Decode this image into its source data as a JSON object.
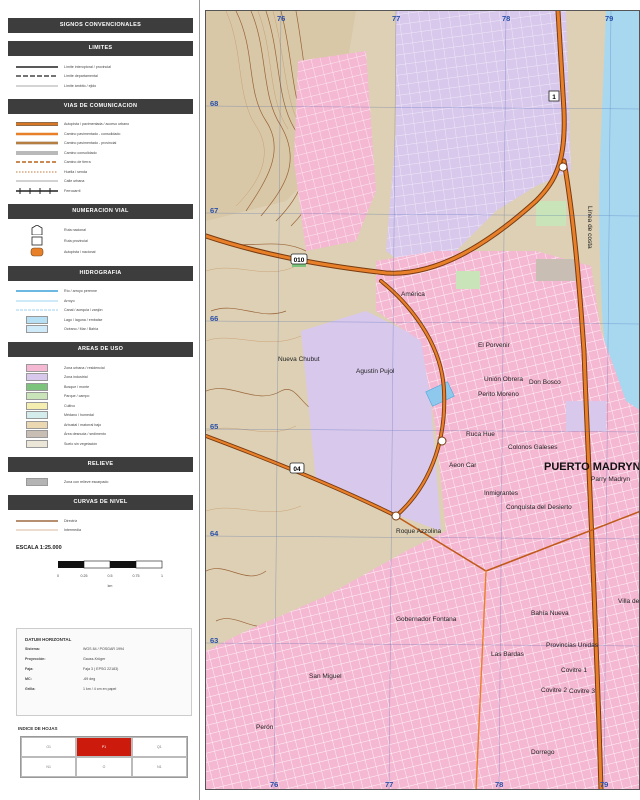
{
  "legend": {
    "title": "SIGNOS CONVENCIONALES",
    "sections": {
      "limites": "LIMITES",
      "vias": "VIAS DE COMUNICACION",
      "numeracion": "NUMERACION VIAL",
      "hidrografia": "HIDROGRAFIA",
      "areas": "AREAS DE USO",
      "relieve": "RELIEVE",
      "curvas": "CURVAS DE NIVEL"
    },
    "limites_items": [
      "Límite interoptoral / provincial",
      "Límite departamental",
      "Límite ámbito / ejido"
    ],
    "vias_items": [
      "Autopista / pavimentada / acceso urbano",
      "Camino pavimentado - consolidado",
      "Camino pavimentado - provincial",
      "Camino consolidado",
      "Camino de tierra",
      "Huella / senda",
      "Calle urbana",
      "Ferrocarril"
    ],
    "numeracion_items": [
      "Ruta nacional",
      "Ruta provincial",
      "Autopista / nacional"
    ],
    "hidro_items": [
      "Río / arroyo perenne",
      "Arroyo",
      "Canal / acequia / zanjón",
      "Lago / laguna / embalse",
      "Océano / Mar / Bahía"
    ],
    "areas_items": [
      "Zona urbana / residencial",
      "Zona industrial",
      "Bosque / monte",
      "Parque / campo",
      "Cultivo",
      "Médano / humedal",
      "Arbustal / matorral bajo",
      "Área desnuda / sedimento",
      "Suelo sin vegetación"
    ],
    "relieve_items": [
      "Zona con relieve escarpado"
    ],
    "curvas_items": [
      "Directriz",
      "Intermedia"
    ],
    "scale": {
      "title": "ESCALA 1:25.000",
      "ticks": [
        "0",
        "0.25",
        "0.5",
        "0.75",
        "1"
      ],
      "unit": "km"
    },
    "datum": {
      "title": "DATUM HORIZONTAL",
      "rows": [
        {
          "k": "Sistema:",
          "v": "WGS 84 / POSGAR 1994"
        },
        {
          "k": "Proyección:",
          "v": "Gauss-Krüger"
        },
        {
          "k": "Faja:",
          "v": "Faja 3 ( EPSG 22183)"
        },
        {
          "k": "MC:",
          "v": "-69 deg"
        },
        {
          "k": "Grilla:",
          "v": "1 km / 4 cm en papel"
        }
      ]
    },
    "index": {
      "title": "INDICE DE HOJAS",
      "cells": [
        "O1",
        "P1",
        "Q1",
        "N1",
        "O",
        "N1"
      ]
    }
  },
  "map": {
    "grid_top": [
      "76",
      "77",
      "78",
      "79"
    ],
    "grid_bottom": [
      "76",
      "77",
      "78",
      "79"
    ],
    "grid_left": [
      "68",
      "67",
      "66",
      "65",
      "64",
      "63"
    ],
    "road_labels": [
      "1",
      "010",
      "04"
    ],
    "coast_label": "Línea de costa",
    "city": "PUERTO MADRYN",
    "places": [
      "América",
      "El Porvenir",
      "Nueva Chubut",
      "Agustín Pujol",
      "Unión Obrera",
      "Don Bosco",
      "Perito Moreno",
      "Ruca Hue",
      "Colonos Galeses",
      "Parry Madryn",
      "Aeon Car",
      "Inmigrantes",
      "Conquista del Desierto",
      "Roque Azzolina",
      "Bahía Nueva",
      "Villa de",
      "Gobernador Fontana",
      "Las Bardas",
      "Provincias Unidas",
      "Covitre 1",
      "Covitre 2",
      "Covitre 3",
      "San Miguel",
      "Perón",
      "Dorrego"
    ]
  }
}
